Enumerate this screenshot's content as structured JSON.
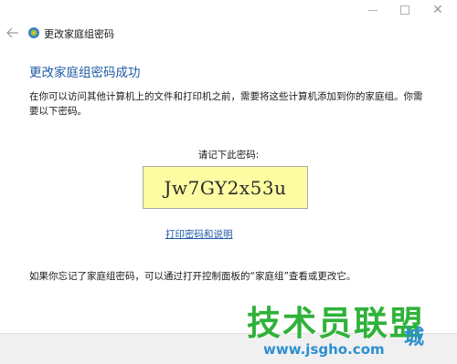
{
  "window": {
    "title": "更改家庭组密码"
  },
  "icons": {
    "back": "back-arrow-icon",
    "app": "homegroup-icon",
    "minimize": "minimize-icon",
    "maximize": "maximize-icon",
    "close": "close-icon"
  },
  "content": {
    "heading": "更改家庭组密码成功",
    "description": "在你可以访问其他计算机上的文件和打印机之前，需要将这些计算机添加到你的家庭组。你需要以下密码。",
    "remember_label": "请记下此密码:",
    "password": "Jw7GY2x53u",
    "print_link": "打印密码和说明",
    "footer_note": "如果你忘记了家庭组密码，可以通过打开控制面板的“家庭组”查看或更改它。"
  },
  "watermark": {
    "main": "技术员联盟",
    "url": "www.jsgho.com",
    "suffix": "城"
  },
  "colors": {
    "heading": "#1f5aa6",
    "link": "#1f5aa6",
    "password_bg": "#fefca2",
    "watermark_green": "#2fb23a",
    "watermark_blue": "#2d8fd0"
  }
}
